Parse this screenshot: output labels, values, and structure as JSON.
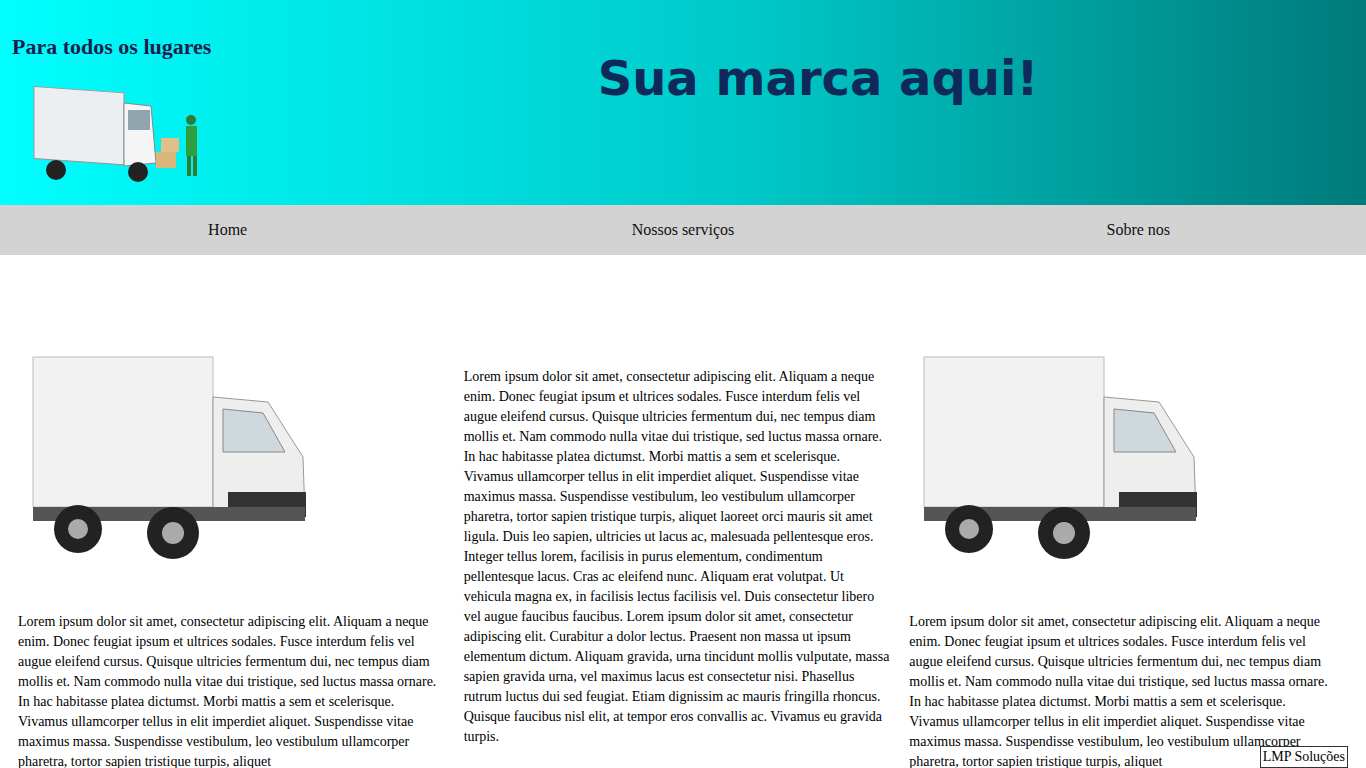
{
  "header": {
    "tagline": "Para todos os lugares",
    "brand": "Sua marca aqui!"
  },
  "nav": {
    "items": [
      {
        "label": "Home"
      },
      {
        "label": "Nossos serviços"
      },
      {
        "label": "Sobre nos"
      }
    ]
  },
  "columns": [
    {
      "kind": "image-text",
      "text": "Lorem ipsum dolor sit amet, consectetur adipiscing elit. Aliquam a neque enim. Donec feugiat ipsum et ultrices sodales. Fusce interdum felis vel augue eleifend cursus. Quisque ultricies fermentum dui, nec tempus diam mollis et. Nam commodo nulla vitae dui tristique, sed luctus massa ornare. In hac habitasse platea dictumst. Morbi mattis a sem et scelerisque. Vivamus ullamcorper tellus in elit imperdiet aliquet. Suspendisse vitae maximus massa. Suspendisse vestibulum, leo vestibulum ullamcorper pharetra, tortor sapien tristique turpis, aliquet"
    },
    {
      "kind": "text",
      "text": "Lorem ipsum dolor sit amet, consectetur adipiscing elit. Aliquam a neque enim. Donec feugiat ipsum et ultrices sodales. Fusce interdum felis vel augue eleifend cursus. Quisque ultricies fermentum dui, nec tempus diam mollis et. Nam commodo nulla vitae dui tristique, sed luctus massa ornare. In hac habitasse platea dictumst. Morbi mattis a sem et scelerisque. Vivamus ullamcorper tellus in elit imperdiet aliquet. Suspendisse vitae maximus massa. Suspendisse vestibulum, leo vestibulum ullamcorper pharetra, tortor sapien tristique turpis, aliquet laoreet orci mauris sit amet ligula. Duis leo sapien, ultricies ut lacus ac, malesuada pellentesque eros. Integer tellus lorem, facilisis in purus elementum, condimentum pellentesque lacus. Cras ac eleifend nunc. Aliquam erat volutpat. Ut vehicula magna ex, in facilisis lectus facilisis vel. Duis consectetur libero vel augue faucibus faucibus. Lorem ipsum dolor sit amet, consectetur adipiscing elit. Curabitur a dolor lectus. Praesent non massa ut ipsum elementum dictum. Aliquam gravida, urna tincidunt mollis vulputate, massa sapien gravida urna, vel maximus lacus est consectetur nisi. Phasellus rutrum luctus dui sed feugiat. Etiam dignissim ac mauris fringilla rhoncus. Quisque faucibus nisl elit, at tempor eros convallis ac. Vivamus eu gravida turpis."
    },
    {
      "kind": "image-text",
      "text": "Lorem ipsum dolor sit amet, consectetur adipiscing elit. Aliquam a neque enim. Donec feugiat ipsum et ultrices sodales. Fusce interdum felis vel augue eleifend cursus. Quisque ultricies fermentum dui, nec tempus diam mollis et. Nam commodo nulla vitae dui tristique, sed luctus massa ornare. In hac habitasse platea dictumst. Morbi mattis a sem et scelerisque. Vivamus ullamcorper tellus in elit imperdiet aliquet. Suspendisse vitae maximus massa. Suspendisse vestibulum, leo vestibulum ullamcorper pharetra, tortor sapien tristique turpis, aliquet"
    }
  ],
  "footer": {
    "text": "LMP Soluções"
  }
}
